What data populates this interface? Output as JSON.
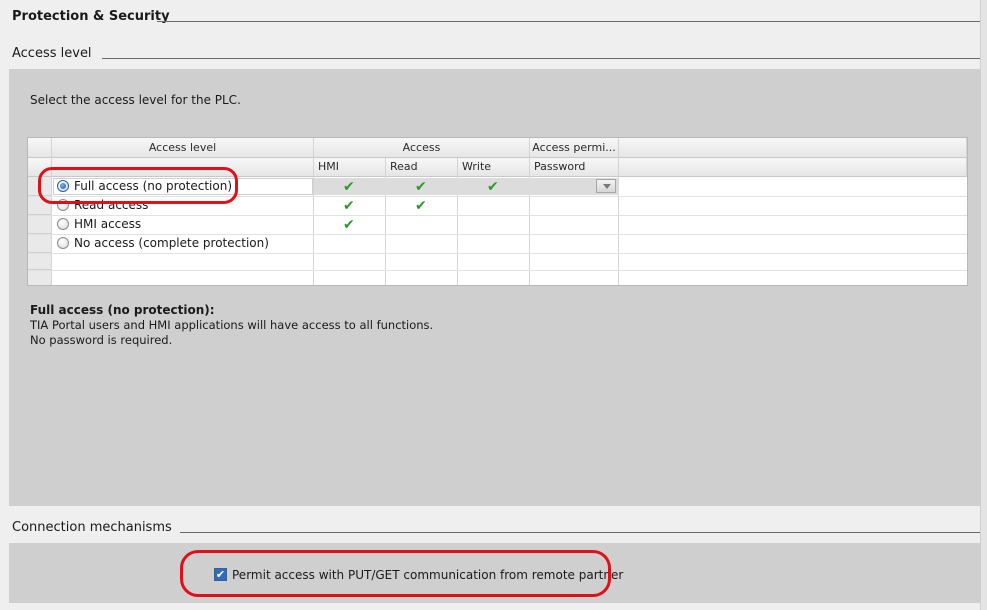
{
  "section_title": "Protection & Security",
  "access_level": {
    "heading": "Access level",
    "instruction": "Select the access level for the PLC.",
    "table": {
      "col_access_level": "Access level",
      "col_access": "Access",
      "col_access_perm": "Access permi...",
      "sub_hmi": "HMI",
      "sub_read": "Read",
      "sub_write": "Write",
      "sub_password": "Password",
      "rows": [
        {
          "label": "Full access (no protection)",
          "selected": true,
          "hmi": true,
          "read": true,
          "write": true
        },
        {
          "label": "Read access",
          "selected": false,
          "hmi": true,
          "read": true,
          "write": false
        },
        {
          "label": "HMI access",
          "selected": false,
          "hmi": true,
          "read": false,
          "write": false
        },
        {
          "label": "No access (complete protection)",
          "selected": false,
          "hmi": false,
          "read": false,
          "write": false
        }
      ],
      "check_glyph": "✔"
    },
    "description": {
      "title": "Full access (no protection):",
      "line1": "TIA Portal users and HMI applications will have access to all functions.",
      "line2": "No password is required."
    }
  },
  "connection": {
    "heading": "Connection mechanisms",
    "permit_putget": {
      "label": "Permit access with PUT/GET communication from remote partner",
      "checked": true,
      "check_glyph": "✔"
    }
  },
  "colors": {
    "highlight_annotation": "#e0101a",
    "check_green": "#2a9a2a",
    "panel_bg": "#cfcfcf"
  }
}
